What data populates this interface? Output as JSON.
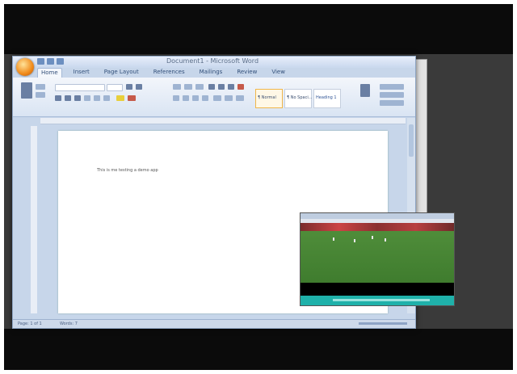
{
  "window": {
    "title": "Document1 - Microsoft Word"
  },
  "ribbon": {
    "tabs": [
      {
        "label": "Home"
      },
      {
        "label": "Insert"
      },
      {
        "label": "Page Layout"
      },
      {
        "label": "References"
      },
      {
        "label": "Mailings"
      },
      {
        "label": "Review"
      },
      {
        "label": "View"
      }
    ],
    "styles": [
      {
        "label": "¶ Normal"
      },
      {
        "label": "¶ No Spaci..."
      },
      {
        "label": "Heading 1"
      }
    ]
  },
  "document": {
    "text": "This is me testing a demo app"
  },
  "statusbar": {
    "page": "Page: 1 of 1",
    "words": "Words: 7"
  }
}
